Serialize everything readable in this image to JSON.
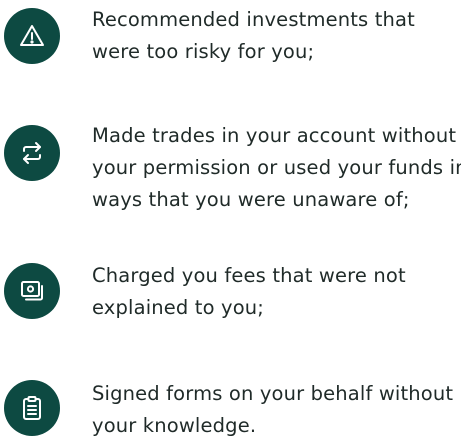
{
  "items": [
    {
      "icon": "warning-icon",
      "lines": [
        "Recommended investments that",
        "were too risky for you;"
      ]
    },
    {
      "icon": "swap-arrows-icon",
      "lines": [
        "Made trades in your account without",
        "your permission or used your funds in",
        "ways that you were unaware of;"
      ]
    },
    {
      "icon": "money-bill-icon",
      "lines": [
        "Charged you fees that were not",
        "explained to you;"
      ]
    },
    {
      "icon": "clipboard-icon",
      "lines": [
        "Signed forms on your behalf without",
        "your knowledge."
      ]
    }
  ],
  "colors": {
    "icon_background": "#0d4a42",
    "icon_foreground": "#ffffff",
    "text": "#1f2a28"
  }
}
